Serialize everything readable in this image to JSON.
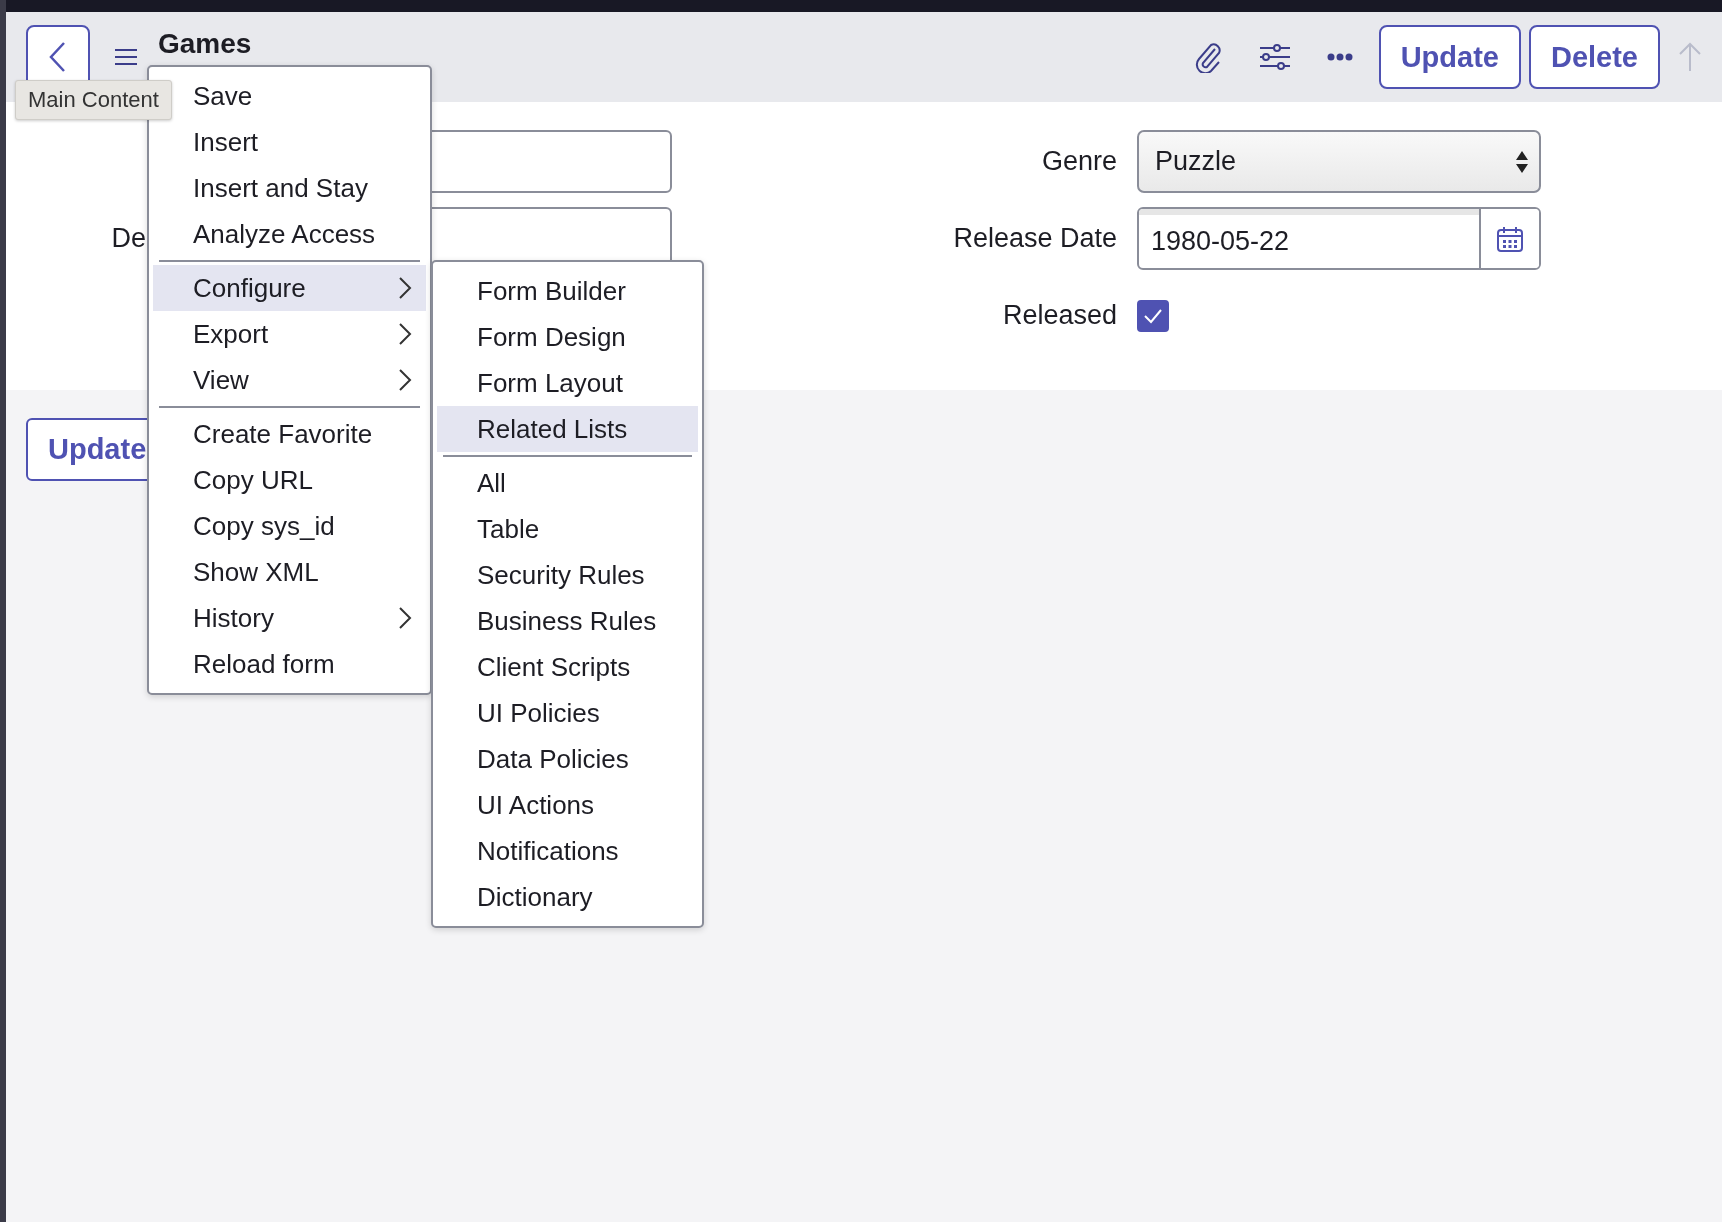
{
  "header": {
    "title": "Games",
    "tooltip": "Main Content",
    "actions": [
      "Update",
      "Delete"
    ]
  },
  "form": {
    "left_fields": [
      {
        "kind": "text"
      },
      {
        "kind": "text",
        "label": "De"
      }
    ],
    "right_fields": [
      {
        "kind": "select",
        "label": "Genre",
        "value": "Puzzle"
      },
      {
        "kind": "date",
        "label": "Release Date",
        "value": "1980-05-22"
      },
      {
        "kind": "checkbox",
        "label": "Released",
        "checked": true
      }
    ]
  },
  "bottom_buttons": [
    "Update"
  ],
  "context_menu": {
    "items": [
      {
        "kind": "item",
        "label": "Save",
        "submenu": false,
        "selected": false
      },
      {
        "kind": "item",
        "label": "Insert",
        "submenu": false,
        "selected": false
      },
      {
        "kind": "item",
        "label": "Insert and Stay",
        "submenu": false,
        "selected": false
      },
      {
        "kind": "item",
        "label": "Analyze Access",
        "submenu": false,
        "selected": false
      },
      {
        "kind": "divider"
      },
      {
        "kind": "item",
        "label": "Configure",
        "submenu": true,
        "selected": true
      },
      {
        "kind": "item",
        "label": "Export",
        "submenu": true,
        "selected": false
      },
      {
        "kind": "item",
        "label": "View",
        "submenu": true,
        "selected": false
      },
      {
        "kind": "divider"
      },
      {
        "kind": "item",
        "label": "Create Favorite",
        "submenu": false,
        "selected": false
      },
      {
        "kind": "item",
        "label": "Copy URL",
        "submenu": false,
        "selected": false
      },
      {
        "kind": "item",
        "label": "Copy sys_id",
        "submenu": false,
        "selected": false
      },
      {
        "kind": "item",
        "label": "Show XML",
        "submenu": false,
        "selected": false
      },
      {
        "kind": "item",
        "label": "History",
        "submenu": true,
        "selected": false
      },
      {
        "kind": "item",
        "label": "Reload form",
        "submenu": false,
        "selected": false
      }
    ]
  },
  "submenu": {
    "items": [
      {
        "kind": "item",
        "label": "Form Builder",
        "selected": false
      },
      {
        "kind": "item",
        "label": "Form Design",
        "selected": false
      },
      {
        "kind": "item",
        "label": "Form Layout",
        "selected": false
      },
      {
        "kind": "item",
        "label": "Related Lists",
        "selected": true
      },
      {
        "kind": "divider"
      },
      {
        "kind": "item",
        "label": "All",
        "selected": false
      },
      {
        "kind": "item",
        "label": "Table",
        "selected": false
      },
      {
        "kind": "item",
        "label": "Security Rules",
        "selected": false
      },
      {
        "kind": "item",
        "label": "Business Rules",
        "selected": false
      },
      {
        "kind": "item",
        "label": "Client Scripts",
        "selected": false
      },
      {
        "kind": "item",
        "label": "UI Policies",
        "selected": false
      },
      {
        "kind": "item",
        "label": "Data Policies",
        "selected": false
      },
      {
        "kind": "item",
        "label": "UI Actions",
        "selected": false
      },
      {
        "kind": "item",
        "label": "Notifications",
        "selected": false
      },
      {
        "kind": "item",
        "label": "Dictionary",
        "selected": false
      }
    ]
  }
}
